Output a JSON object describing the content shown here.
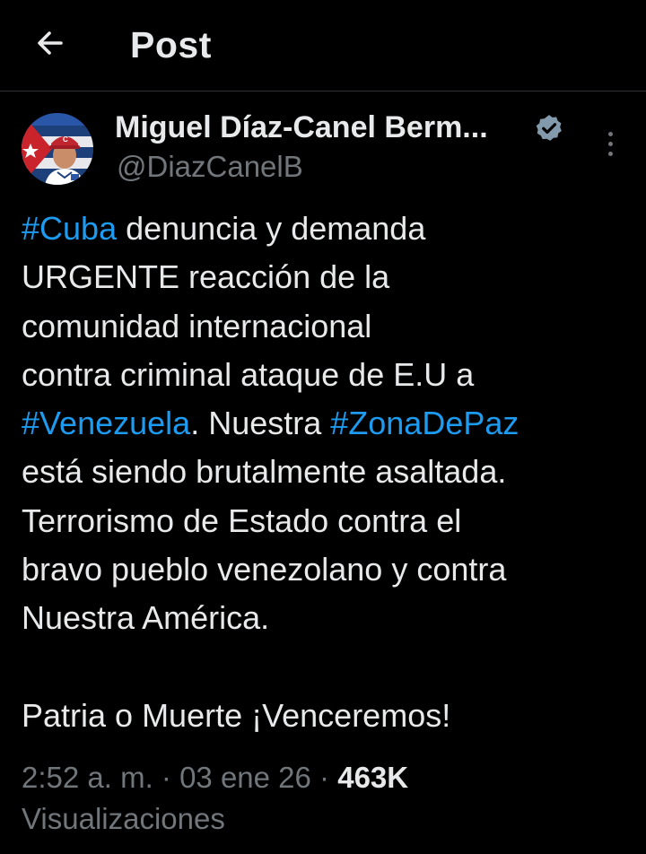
{
  "header": {
    "title": "Post",
    "back_icon": "arrow-left-icon"
  },
  "author": {
    "name": "Miguel Díaz-Canel Berm...",
    "handle": "@DiazCanelB",
    "verified_icon": "verified-badge-icon",
    "avatar_icon": "avatar"
  },
  "post": {
    "lines": [
      [
        {
          "text": "#Cuba",
          "tag": true
        },
        {
          "text": " denuncia y demanda",
          "tag": false
        }
      ],
      [
        {
          "text": "URGENTE reacción de la",
          "tag": false
        }
      ],
      [
        {
          "text": "comunidad internacional",
          "tag": false
        }
      ],
      [
        {
          "text": "contra criminal ataque de E.U a",
          "tag": false
        }
      ],
      [
        {
          "text": "#Venezuela",
          "tag": true
        },
        {
          "text": ". Nuestra ",
          "tag": false
        },
        {
          "text": "#ZonaDePaz",
          "tag": true
        }
      ],
      [
        {
          "text": "está siendo brutalmente asaltada.",
          "tag": false
        }
      ],
      [
        {
          "text": "Terrorismo de Estado contra el",
          "tag": false
        }
      ],
      [
        {
          "text": "bravo pueblo venezolano y contra",
          "tag": false
        }
      ],
      [
        {
          "text": "Nuestra América.",
          "tag": false
        }
      ],
      [
        {
          "text": "",
          "tag": false
        }
      ],
      [
        {
          "text": "Patria o Muerte ¡Venceremos!",
          "tag": false
        }
      ]
    ]
  },
  "meta": {
    "time": "2:52 a. m.",
    "separator": " · ",
    "date": "03 ene 26",
    "views_count": "463K",
    "views_label": "Visualizaciones"
  },
  "colors": {
    "background": "#000000",
    "text": "#e7e9ea",
    "secondary": "#71767b",
    "hashtag": "#1d9bf0",
    "verified": "#829aab"
  }
}
